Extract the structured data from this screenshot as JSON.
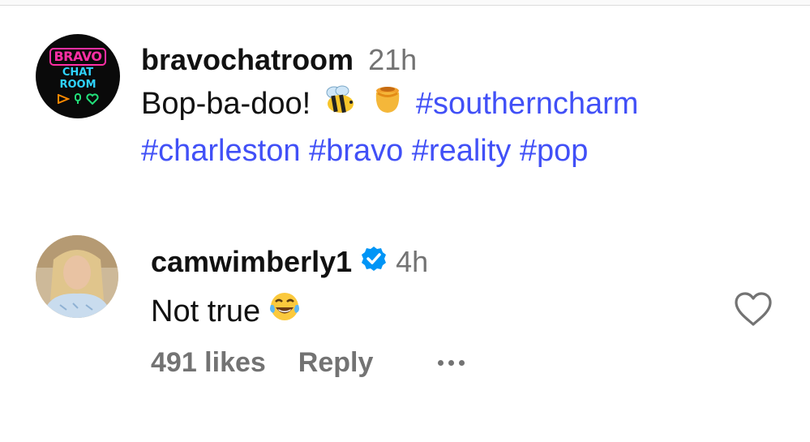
{
  "post": {
    "avatar": {
      "text_top": "BRAVO",
      "text_mid": "CHAT",
      "text_bottom": "ROOM"
    },
    "username": "bravochatroom",
    "time": "21h",
    "caption_text": "Bop-ba-doo!",
    "emojis": [
      "bee",
      "honey-pot"
    ],
    "hashtags": [
      "#southerncharm",
      "#charleston",
      "#bravo",
      "#reality",
      "#pop"
    ]
  },
  "comment": {
    "username": "camwimberly1",
    "verified": true,
    "time": "4h",
    "text": "Not true",
    "emoji": "face-with-tears-of-joy",
    "likes": "491 likes",
    "reply_label": "Reply",
    "like_icon": "heart-icon",
    "more_icon": "more-options-icon"
  },
  "colors": {
    "hashtag": "#4150f7",
    "secondary_text": "#737373",
    "verified_badge": "#0095f6"
  }
}
